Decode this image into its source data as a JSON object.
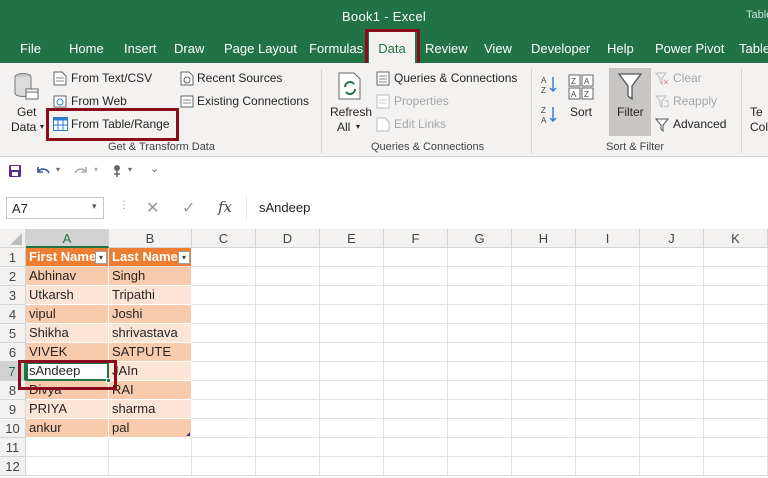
{
  "window": {
    "title": "Book1  -  Excel",
    "context_tab": "Table"
  },
  "tabs": [
    "File",
    "Home",
    "Insert",
    "Draw",
    "Page Layout",
    "Formulas",
    "Data",
    "Review",
    "View",
    "Developer",
    "Help",
    "Power Pivot",
    "Table"
  ],
  "active_tab": "Data",
  "ribbon": {
    "get_transform": {
      "get_data": [
        "Get",
        "Data"
      ],
      "from_text_csv": "From Text/CSV",
      "from_web": "From Web",
      "from_table_range": "From Table/Range",
      "recent_sources": "Recent Sources",
      "existing_connections": "Existing Connections",
      "group_label": "Get & Transform Data"
    },
    "queries": {
      "refresh_all": [
        "Refresh",
        "All"
      ],
      "queries_connections": "Queries & Connections",
      "properties": "Properties",
      "edit_links": "Edit Links",
      "group_label": "Queries & Connections"
    },
    "sort_filter": {
      "sort": "Sort",
      "filter": "Filter",
      "clear": "Clear",
      "reapply": "Reapply",
      "advanced": "Advanced",
      "group_label": "Sort & Filter"
    },
    "cut_off": {
      "line1": "Te",
      "line2": "Col"
    }
  },
  "formula_bar": {
    "name_box": "A7",
    "fx": "fx",
    "value": "sAndeep"
  },
  "columns": [
    "A",
    "B",
    "C",
    "D",
    "E",
    "F",
    "G",
    "H",
    "I",
    "J",
    "K"
  ],
  "rows": [
    "1",
    "2",
    "3",
    "4",
    "5",
    "6",
    "7",
    "8",
    "9",
    "10",
    "11",
    "12"
  ],
  "table": {
    "headers": [
      "First Name",
      "Last Name"
    ],
    "data": [
      [
        "Abhinav",
        "Singh"
      ],
      [
        "Utkarsh",
        " Tripathi"
      ],
      [
        "    vipul",
        "Joshi"
      ],
      [
        " Shikha",
        " shrivastava"
      ],
      [
        "VIVEK",
        "SATPUTE"
      ],
      [
        "sAndeep",
        "JAIn"
      ],
      [
        "Divya",
        "RAI"
      ],
      [
        "PRIYA",
        "sharma"
      ],
      [
        "ankur",
        "pal"
      ]
    ]
  },
  "colors": {
    "excel_green": "#217346",
    "header_orange": "#ed7d31",
    "band_dark": "#f8cbad",
    "band_light": "#fce4d6",
    "highlight": "#8b0d1d"
  }
}
